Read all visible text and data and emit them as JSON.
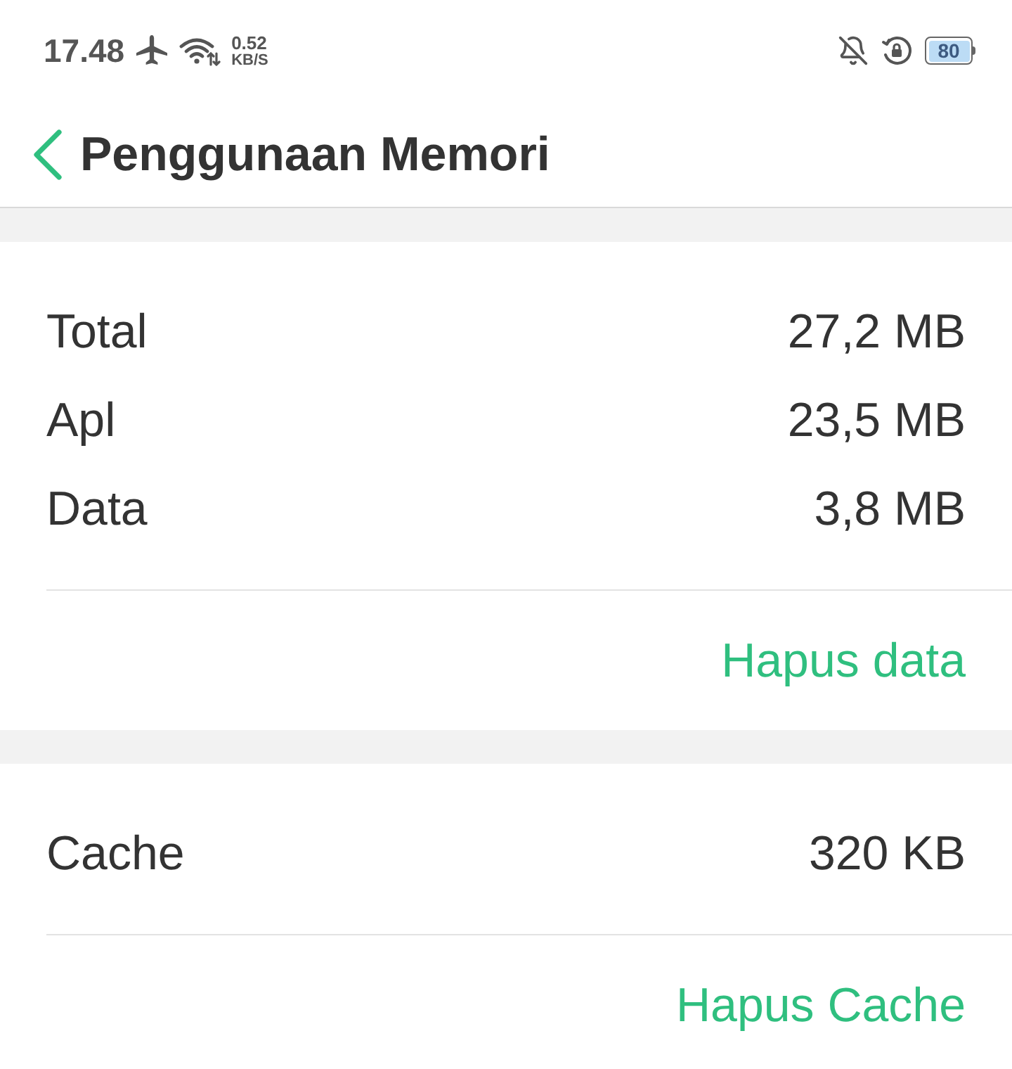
{
  "status_bar": {
    "time": "17.48",
    "net_speed": {
      "value": "0.52",
      "unit": "KB/S"
    },
    "battery": "80"
  },
  "header": {
    "title": "Penggunaan Memori"
  },
  "sections": [
    {
      "rows": [
        {
          "label": "Total",
          "value": "27,2 MB"
        },
        {
          "label": "Apl",
          "value": "23,5 MB"
        },
        {
          "label": "Data",
          "value": "3,8 MB"
        }
      ],
      "action": "Hapus data"
    },
    {
      "rows": [
        {
          "label": "Cache",
          "value": "320 KB"
        }
      ],
      "action": "Hapus Cache"
    }
  ]
}
